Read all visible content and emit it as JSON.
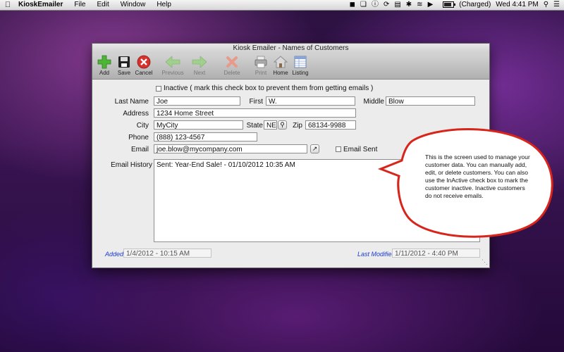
{
  "menubar": {
    "app_name": "KioskEmailer",
    "items": [
      "File",
      "Edit",
      "Window",
      "Help"
    ],
    "battery_status": "(Charged)",
    "clock": "Wed 4:41 PM"
  },
  "window": {
    "title": "Kiosk Emailer - Names of Customers"
  },
  "toolbar": {
    "add": "Add",
    "save": "Save",
    "cancel": "Cancel",
    "previous": "Previous",
    "next": "Next",
    "delete": "Delete",
    "print": "Print",
    "home": "Home",
    "listing": "Listing"
  },
  "form": {
    "inactive_label": "Inactive ( mark this check box to prevent them from getting emails )",
    "last_name_label": "Last Name",
    "last_name_value": "Joe",
    "first_label": "First",
    "first_value": "W.",
    "middle_label": "Middle",
    "middle_value": "Blow",
    "address_label": "Address",
    "address_value": "1234 Home Street",
    "city_label": "City",
    "city_value": "MyCity",
    "state_label": "State",
    "state_value": "NE",
    "zip_label": "Zip",
    "zip_value": "68134-9988",
    "phone_label": "Phone",
    "phone_value": "(888) 123-4567",
    "email_label": "Email",
    "email_value": "joe.blow@mycompany.com",
    "email_sent_label": "Email Sent",
    "email_history_label": "Email History",
    "email_history_value": "Sent:  Year-End Sale! - 01/10/2012 10:35 AM",
    "added_label": "Added",
    "added_value": "1/4/2012 - 10:15 AM",
    "last_modified_label": "Last Modified",
    "last_modified_value": "1/11/2012 - 4:40 PM"
  },
  "callout": {
    "text": "This is the screen used to manage your customer data.  You can manually add, edit, or delete customers.  You can also use the InActive check box to mark the customer inactive.  Inactive customers do not receive emails."
  },
  "colors": {
    "add_icon": "#4fb536",
    "cancel_icon": "#d8302a",
    "nav_disabled": "#9fd08c",
    "label_blue": "#1a3ad0"
  }
}
